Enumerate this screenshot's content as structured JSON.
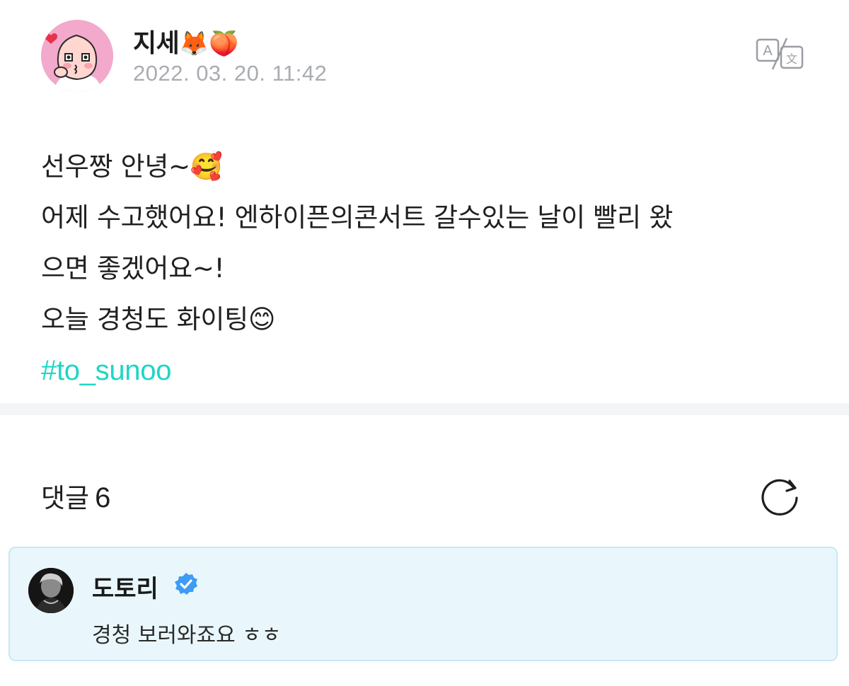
{
  "post": {
    "author": {
      "name": "지세",
      "name_emojis": "🦊🍑"
    },
    "date": "2022. 03. 20. 11:42",
    "translate_icon": "translate-icon",
    "body": {
      "line1": "선우짱 안녕~🥰",
      "line2": "어제 수고했어요! 엔하이픈의콘서트 갈수있는 날이 빨리 왔",
      "line3": "으면 좋겠어요~!",
      "line4": "오늘 경청도 화이팅😊"
    },
    "hashtag": "#to_sunoo"
  },
  "comments": {
    "title": "댓글",
    "count": "6",
    "refresh_icon": "refresh-icon",
    "highlighted": {
      "author": "도토리",
      "verified_icon": "verified-badge-icon",
      "text": "경청 보러와죠요 ㅎㅎ"
    }
  },
  "colors": {
    "hashtag": "#1fd6c4",
    "date": "#a9acb2",
    "divider": "#f4f5f7",
    "comment_bg": "#e9f7fd",
    "comment_border": "#c5e9f6",
    "verified": "#3d9cf5"
  }
}
